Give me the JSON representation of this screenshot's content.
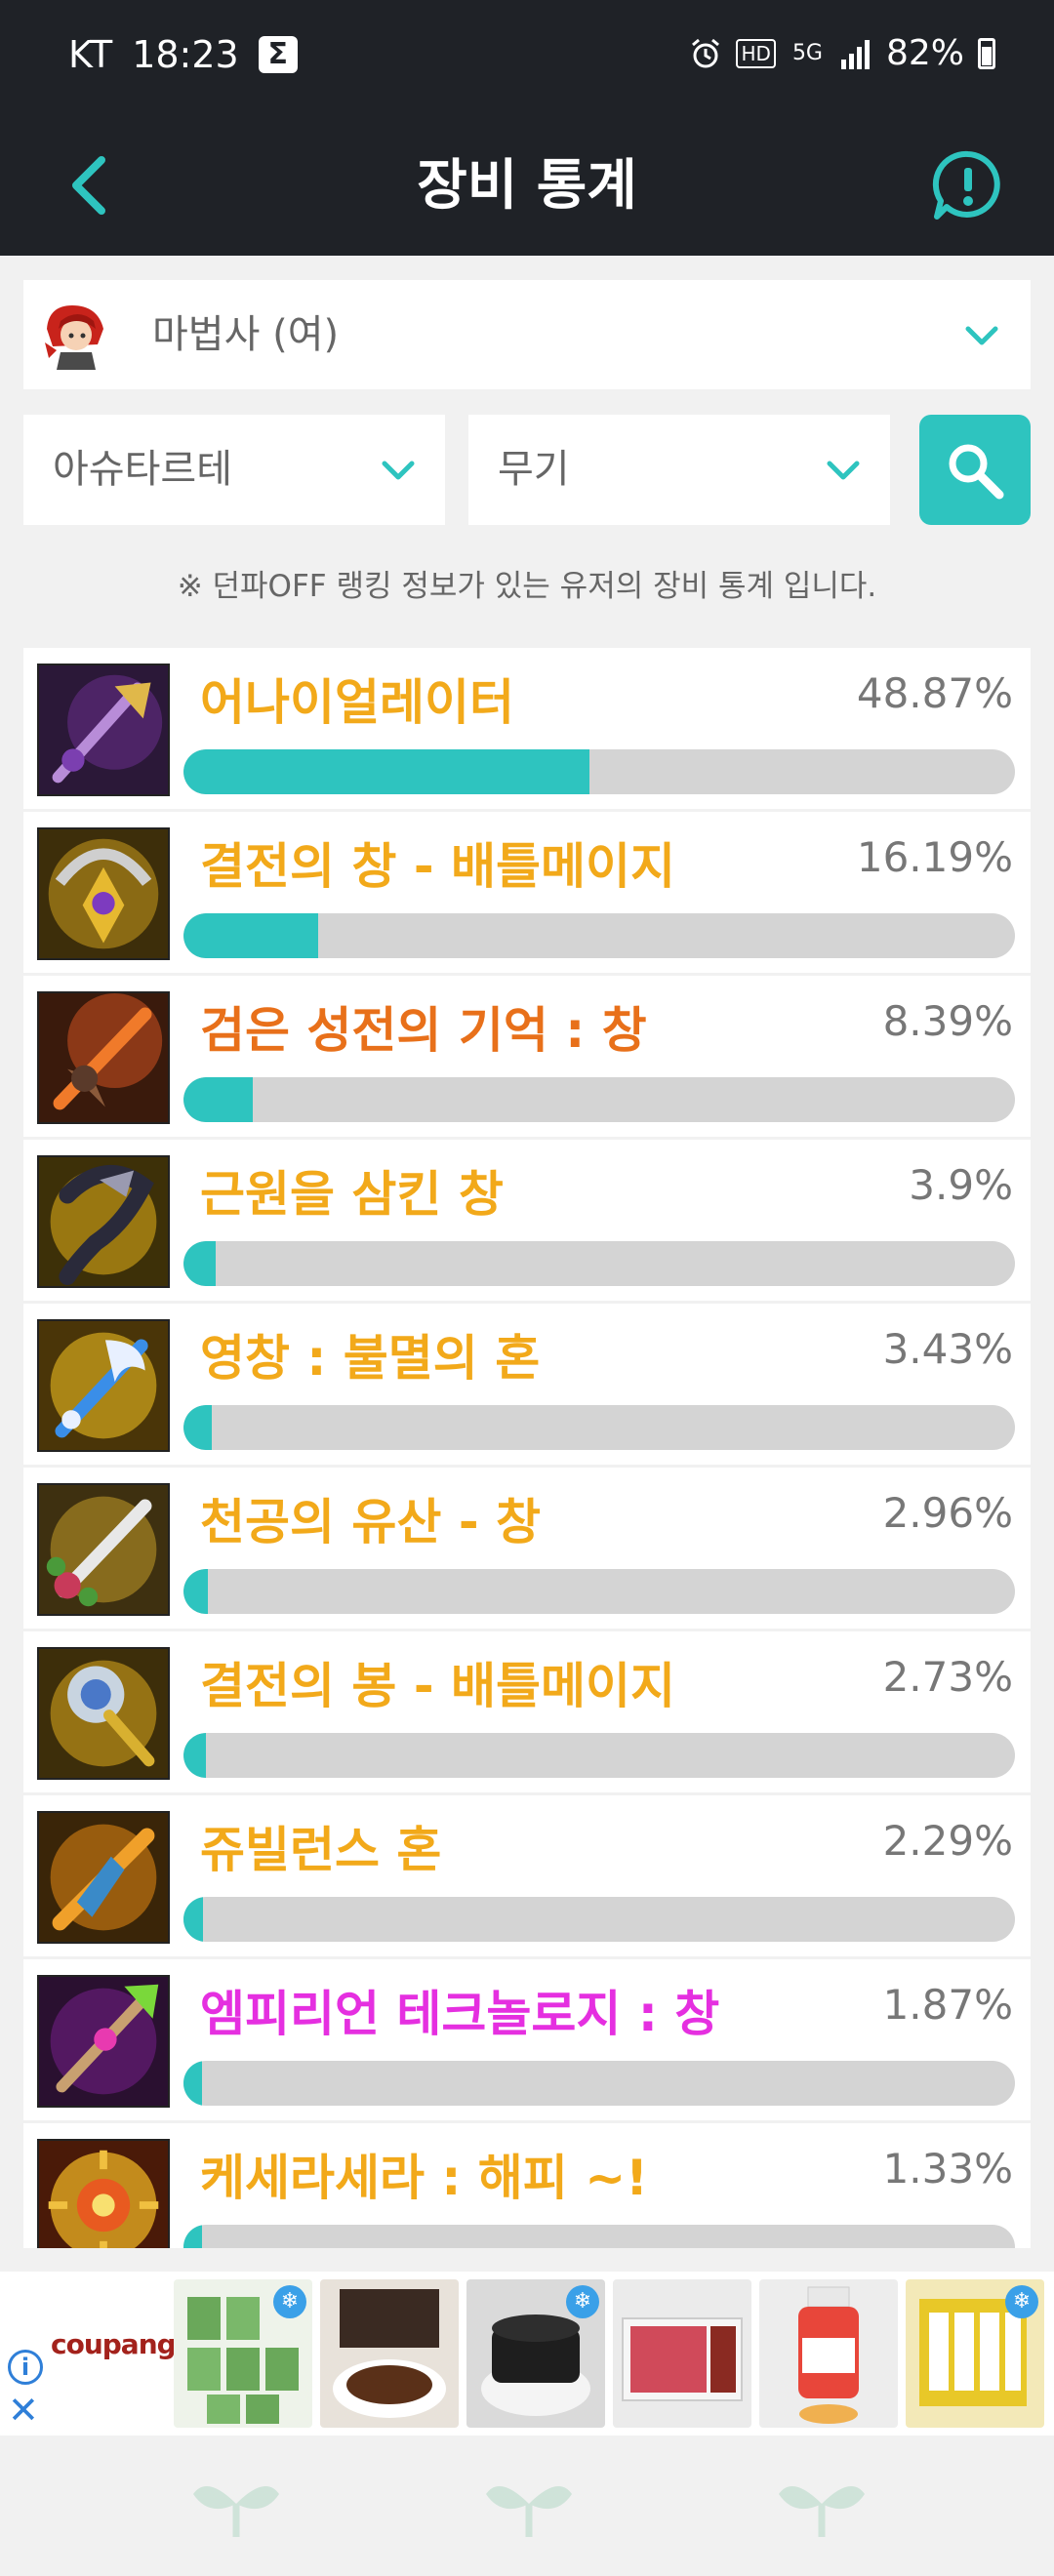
{
  "status_bar": {
    "carrier": "KT",
    "time": "18:23",
    "sigma": "Σ",
    "hd": "HD",
    "net": "5G",
    "battery": "82%"
  },
  "header": {
    "title": "장비 통계"
  },
  "character": {
    "selected": "마법사 (여)"
  },
  "filters": {
    "server": "아슈타르테",
    "slot": "무기"
  },
  "notice": "※ 던파OFF 랭킹 정보가 있는 유저의 장비 통계 입니다.",
  "colors": {
    "accent": "#2ec4bf",
    "epic": "#f2a91a",
    "legendary": "#e8701a",
    "primeval": "#e52fe0"
  },
  "items": [
    {
      "name": "어나이얼레이터",
      "percent": "48.87%",
      "value": 48.87,
      "color": "#f2a91a",
      "icon": "annihilator-staff-icon"
    },
    {
      "name": "결전의 창 - 배틀메이지",
      "percent": "16.19%",
      "value": 16.19,
      "color": "#f2a91a",
      "icon": "decisive-spear-icon"
    },
    {
      "name": "검은 성전의 기억 : 창",
      "percent": "8.39%",
      "value": 8.39,
      "color": "#e8701a",
      "icon": "black-crusade-spear-icon"
    },
    {
      "name": "근원을 삼킨 창",
      "percent": "3.9%",
      "value": 3.9,
      "color": "#f2a91a",
      "icon": "origin-devouring-spear-icon"
    },
    {
      "name": "영창 : 불멸의 혼",
      "percent": "3.43%",
      "value": 3.43,
      "color": "#f2a91a",
      "icon": "immortal-soul-spear-icon"
    },
    {
      "name": "천공의 유산 - 창",
      "percent": "2.96%",
      "value": 2.96,
      "color": "#f2a91a",
      "icon": "sky-legacy-spear-icon"
    },
    {
      "name": "결전의 봉 - 배틀메이지",
      "percent": "2.73%",
      "value": 2.73,
      "color": "#f2a91a",
      "icon": "decisive-rod-icon"
    },
    {
      "name": "쥬빌런스 혼",
      "percent": "2.29%",
      "value": 2.29,
      "color": "#f2a91a",
      "icon": "jubilance-soul-icon"
    },
    {
      "name": "엠피리언 테크놀로지 : 창",
      "percent": "1.87%",
      "value": 1.87,
      "color": "#e52fe0",
      "icon": "empyrean-tech-spear-icon"
    },
    {
      "name": "케세라세라 : 해피 ~!",
      "percent": "1.33%",
      "value": 1.33,
      "color": "#f2a91a",
      "icon": "que-sera-sera-icon"
    }
  ],
  "ad": {
    "brand": "coupang"
  }
}
